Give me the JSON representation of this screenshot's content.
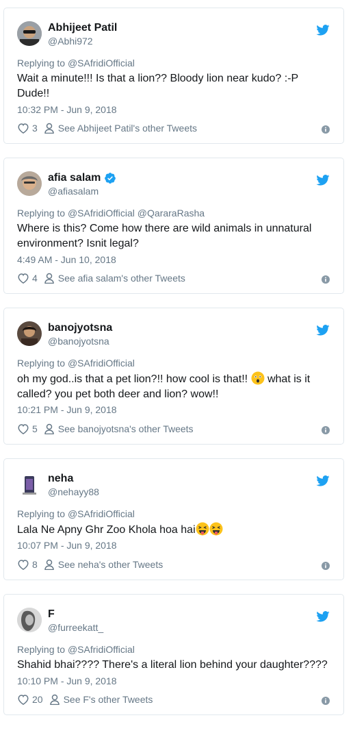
{
  "tweets": [
    {
      "name": "Abhijeet Patil",
      "handle": "@Abhi972",
      "replying_prefix": "Replying to ",
      "replying_to": "@SAfridiOfficial",
      "text_line1": "Wait a minute!!! Is that a lion?? Bloody lion near kudo? :-P",
      "text_line2": "Dude!!",
      "time": "10:32 PM - Jun 9, 2018",
      "likes": "3",
      "see_more": "See Abhijeet Patil's other Tweets"
    },
    {
      "name": "afia salam",
      "handle": "@afiasalam",
      "replying_prefix": "Replying to ",
      "replying_to": "@SAfridiOfficial @QararaRasha",
      "text_line1": "Where is this? Come how there are wild animals in unnatural",
      "text_line2": "environment? Isnit legal?",
      "time": "4:49 AM - Jun 10, 2018",
      "likes": "4",
      "see_more": "See afia salam's other Tweets"
    },
    {
      "name": "banojyotsna",
      "handle": "@banojyotsna",
      "replying_prefix": "Replying to ",
      "replying_to": "@SAfridiOfficial",
      "text_line1a": "oh my god..is that a pet lion?!! how cool is that!! ",
      "text_line1b": " what is it",
      "text_line2": "called? you pet both deer and lion? wow!!",
      "time": "10:21 PM - Jun 9, 2018",
      "likes": "5",
      "see_more": "See banojyotsna's other Tweets"
    },
    {
      "name": "neha",
      "handle": "@nehayy88",
      "replying_prefix": "Replying to ",
      "replying_to": "@SAfridiOfficial",
      "text_line1": "Lala Ne Apny Ghr Zoo Khola hoa hai",
      "time": "10:07 PM - Jun 9, 2018",
      "likes": "8",
      "see_more": "See neha's other Tweets"
    },
    {
      "name": "F",
      "handle": "@furreekatt_",
      "replying_prefix": "Replying to ",
      "replying_to": "@SAfridiOfficial",
      "text_line1": "Shahid bhai???? There's a literal lion behind your daughter????",
      "time": "10:10 PM - Jun 9, 2018",
      "likes": "20",
      "see_more": "See F's other Tweets"
    }
  ],
  "colors": {
    "twitter_blue": "#1da1f2",
    "secondary_text": "#657786",
    "border": "#e1e8ed"
  }
}
